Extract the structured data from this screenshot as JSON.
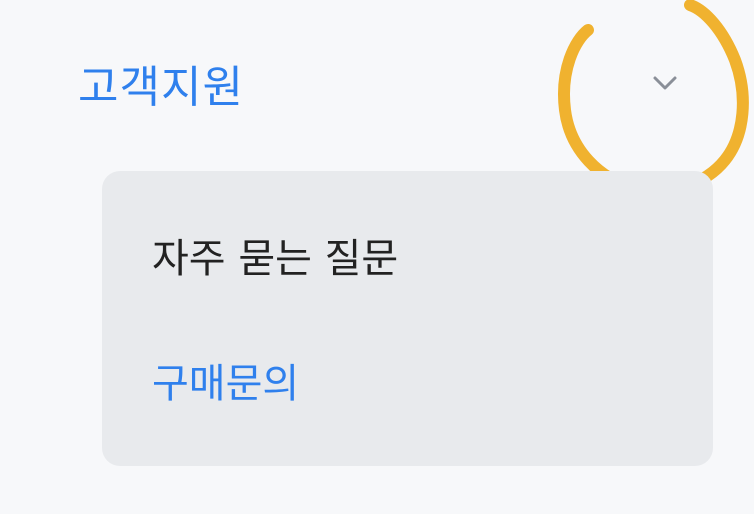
{
  "colors": {
    "background": "#f7f8fa",
    "accent": "#2f80ed",
    "text_primary": "#222222",
    "chevron": "#8a8f98",
    "submenu_bg": "#e8eaed",
    "annotation": "#f0b22f"
  },
  "section": {
    "title": "고객지원",
    "expanded": true,
    "toggle_icon": "chevron-down-icon"
  },
  "submenu": {
    "items": [
      {
        "label": "자주 묻는 질문",
        "active": false
      },
      {
        "label": "구매문의",
        "active": true
      }
    ]
  },
  "annotation": {
    "shape": "hand-drawn-circle",
    "target": "chevron-down-icon"
  }
}
